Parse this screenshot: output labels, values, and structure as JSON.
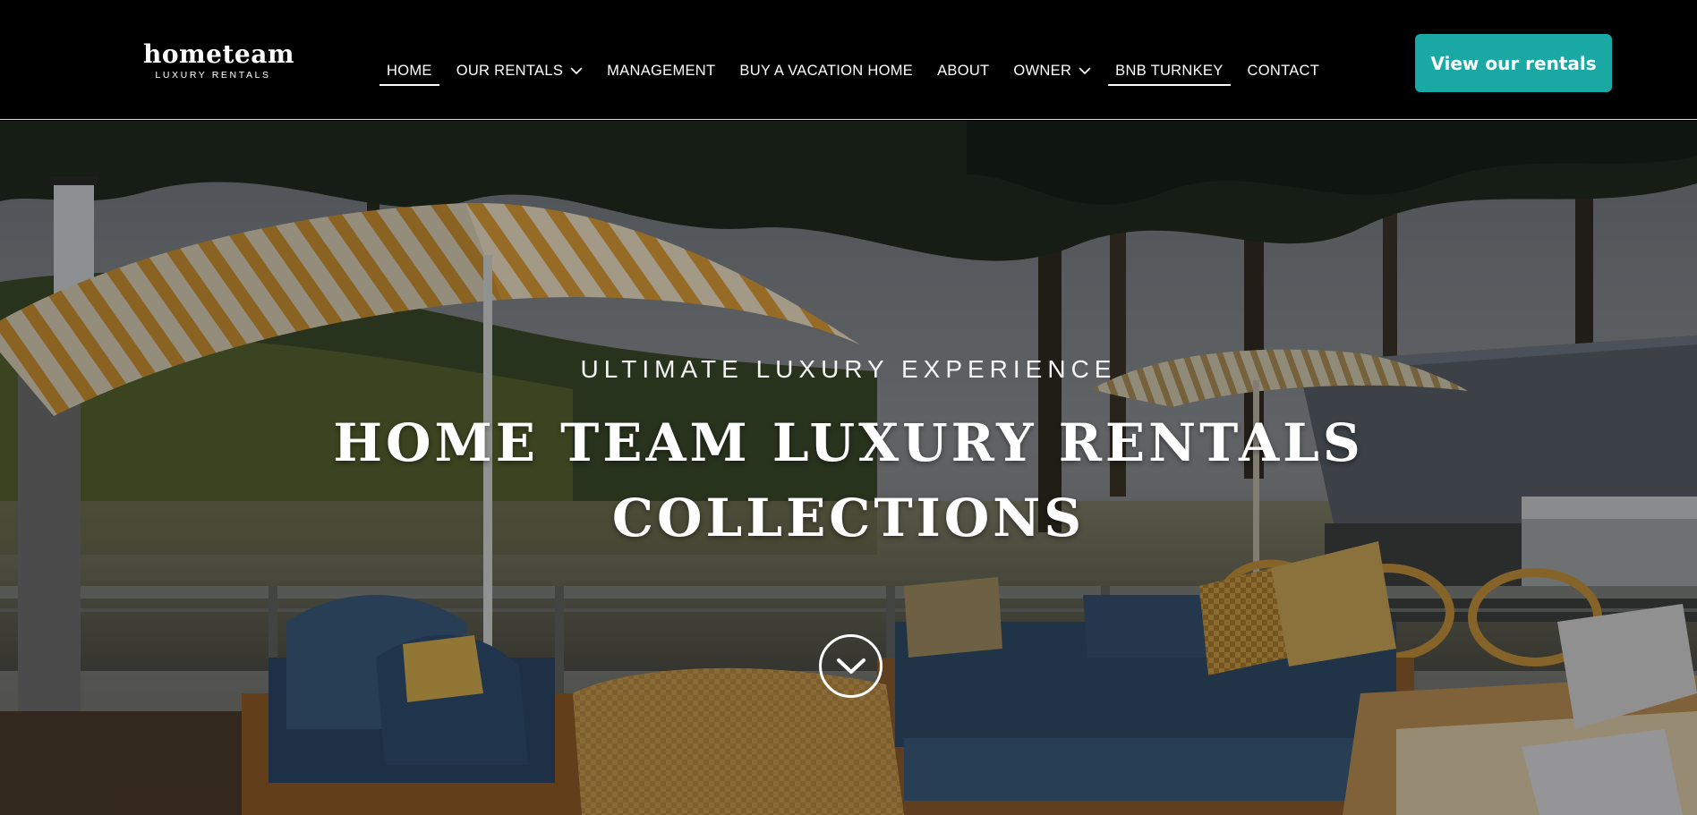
{
  "header": {
    "logo": {
      "name": "hometeam",
      "tagline": "LUXURY RENTALS"
    },
    "nav": [
      {
        "label": "HOME",
        "has_dropdown": false,
        "active": true
      },
      {
        "label": "OUR RENTALS",
        "has_dropdown": true,
        "active": false
      },
      {
        "label": "MANAGEMENT",
        "has_dropdown": false,
        "active": false
      },
      {
        "label": "BUY A VACATION HOME",
        "has_dropdown": false,
        "active": false
      },
      {
        "label": "ABOUT",
        "has_dropdown": false,
        "active": false
      },
      {
        "label": "OWNER",
        "has_dropdown": true,
        "active": false
      },
      {
        "label": "BNB TURNKEY",
        "has_dropdown": false,
        "active": true
      },
      {
        "label": "CONTACT",
        "has_dropdown": false,
        "active": false
      }
    ],
    "cta_label": "View our rentals"
  },
  "hero": {
    "eyebrow": "ULTIMATE LUXURY EXPERIENCE",
    "title_line1": "HOME TEAM LUXURY RENTALS",
    "title_line2": "COLLECTIONS",
    "scroll_icon": "chevron-down-circle-icon"
  },
  "colors": {
    "header_bg": "#000000",
    "cta_bg": "#1aa8a5",
    "text": "#ffffff"
  }
}
